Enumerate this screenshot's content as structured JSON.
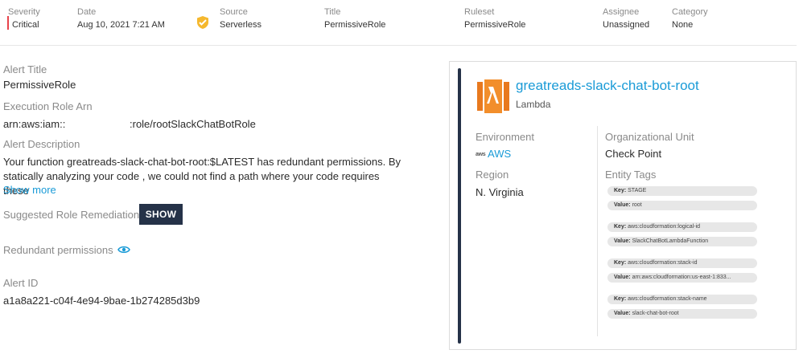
{
  "header": {
    "severity_label": "Severity",
    "severity_value": "Critical",
    "date_label": "Date",
    "date_value": "Aug 10, 2021 7:21 AM",
    "source_label": "Source",
    "source_value": "Serverless",
    "title_label": "Title",
    "title_value": "PermissiveRole",
    "ruleset_label": "Ruleset",
    "ruleset_value": "PermissiveRole",
    "assignee_label": "Assignee",
    "assignee_value": "Unassigned",
    "category_label": "Category",
    "category_value": "None",
    "severity_color": "#e8434b",
    "source_icon": "serverless-shield-icon"
  },
  "details": {
    "alert_title_label": "Alert Title",
    "alert_title_value": "PermissiveRole",
    "role_arn_label": "Execution Role Arn",
    "role_arn_prefix": "arn:aws:iam::",
    "role_arn_suffix": ":role/rootSlackChatBotRole",
    "description_label": "Alert Description",
    "description_text": "Your function greatreads-slack-chat-bot-root:$LATEST has redundant permissions. By statically analyzing your code , we could not find a path where your code requires these",
    "show_more": "Show more",
    "remediation_label": "Suggested Role Remediation",
    "show_button": "SHOW",
    "redundant_label": "Redundant permissions",
    "alert_id_label": "Alert ID",
    "alert_id_value": "a1a8a221-c04f-4e94-9bae-1b274285d3b9"
  },
  "entity": {
    "name": "greatreads-slack-chat-bot-root",
    "type": "Lambda",
    "environment_label": "Environment",
    "environment_value": "AWS",
    "aws_logo_text": "aws",
    "region_label": "Region",
    "region_value": "N. Virginia",
    "org_unit_label": "Organizational Unit",
    "org_unit_value": "Check Point",
    "tags_label": "Entity Tags",
    "tags": [
      {
        "key_label": "Key:",
        "key": "STAGE",
        "value_label": "Value:",
        "value": "root"
      },
      {
        "key_label": "Key:",
        "key": "aws:cloudformation:logical-id",
        "value_label": "Value:",
        "value": "SlackChatBotLambdaFunction"
      },
      {
        "key_label": "Key:",
        "key": "aws:cloudformation:stack-id",
        "value_label": "Value:",
        "value": "arn:aws:cloudformation:us-east-1:833..."
      },
      {
        "key_label": "Key:",
        "key": "aws:cloudformation:stack-name",
        "value_label": "Value:",
        "value": "slack-chat-bot-root"
      }
    ],
    "accent_color": "#1a9bd7",
    "lambda_color": "#e8791e"
  }
}
